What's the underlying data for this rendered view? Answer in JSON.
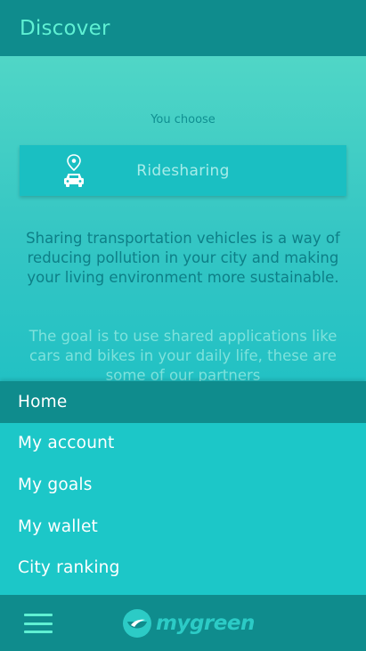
{
  "header": {
    "title": "Discover"
  },
  "main": {
    "choose_label": "You choose",
    "selected_option": {
      "label": "Ridesharing",
      "icon": "car-location-icon"
    },
    "description": "Sharing transportation vehicles is a way of reducing pollution in your city and making your living environment more sustainable.",
    "goal_text": "The goal is to use shared applications like cars and bikes in your daily life, these are some of our partners"
  },
  "menu": {
    "items": [
      {
        "label": "Home",
        "active": true
      },
      {
        "label": "My account",
        "active": false
      },
      {
        "label": "My goals",
        "active": false
      },
      {
        "label": "My wallet",
        "active": false
      },
      {
        "label": "City ranking",
        "active": false
      }
    ]
  },
  "bottom_bar": {
    "menu_icon": "hamburger-menu-icon",
    "logo_text": "mygreen",
    "logo_icon": "leaf-bowl-icon"
  },
  "colors": {
    "primary_dark": "#0f8c8d",
    "primary": "#1cc7c8",
    "accent": "#5ff0d3"
  }
}
